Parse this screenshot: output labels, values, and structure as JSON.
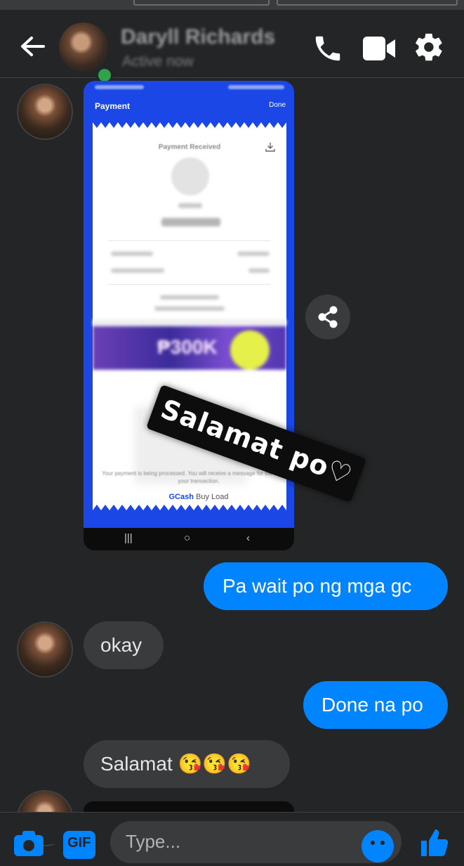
{
  "header": {
    "contact_name": "Daryll Richards",
    "status": "Active now",
    "icons": [
      "back-arrow-icon",
      "phone-icon",
      "video-camera-icon",
      "gear-icon"
    ]
  },
  "attachment": {
    "screenshot": {
      "title": "Payment",
      "done": "Done",
      "receipt_heading": "Payment Received",
      "recipient": "Pay to",
      "amount": "PHP 20.00",
      "rows": [
        {
          "label": "Amount Due",
          "value": "PHP 20.00"
        },
        {
          "label": "Payment Method",
          "value": "GCash"
        }
      ],
      "promo": "₱300K",
      "footnote": "Your payment is being processed. You will receive a message for the status of your transaction.",
      "brand_strong": "GCash",
      "brand_rest": " Buy Load"
    },
    "sticker_text": "Salamat po♡"
  },
  "messages": [
    {
      "from": "me",
      "text": "Pa wait po ng mga gc"
    },
    {
      "from": "them",
      "text": "okay"
    },
    {
      "from": "me",
      "text": "Done na po"
    },
    {
      "from": "them",
      "text": "Salamat 😘😘😘"
    }
  ],
  "composer": {
    "placeholder": "Type...",
    "gif_label": "GIF",
    "icons": [
      "camera-icon",
      "gif-icon",
      "emoji-icon",
      "thumbs-up-icon"
    ]
  },
  "colors": {
    "background": "#242526",
    "sent_bubble": "#0084ff",
    "received_bubble": "#3a3b3c",
    "gcash_blue": "#1a47e6",
    "online": "#31a24c"
  }
}
